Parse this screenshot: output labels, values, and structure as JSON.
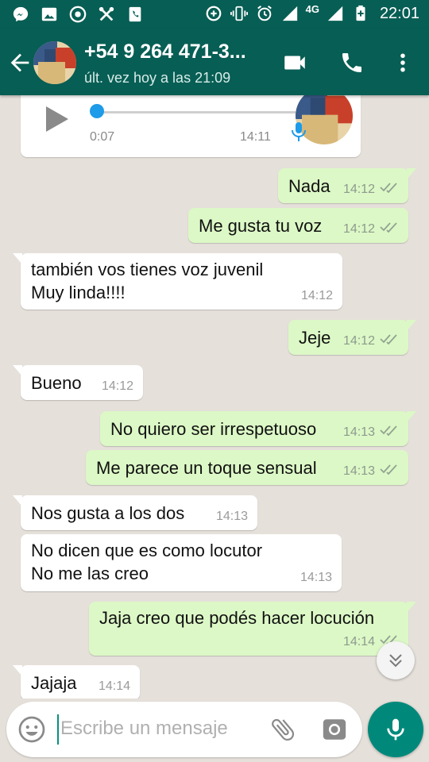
{
  "status_bar": {
    "time": "22:01",
    "network": "4G",
    "left_icons": [
      "messenger-icon",
      "gallery-icon",
      "chrome-icon",
      "tools-icon",
      "phone-app-icon"
    ],
    "right_icons": [
      "data-saver-icon",
      "vibrate-icon",
      "alarm-icon",
      "signal-icon",
      "signal-icon",
      "battery-charging-icon"
    ]
  },
  "header": {
    "contact_name": "+54 9 264 471-3...",
    "last_seen": "últ. vez hoy a las 21:09"
  },
  "voice_note": {
    "duration": "0:07",
    "time": "14:11",
    "progress": 0
  },
  "messages": [
    {
      "dir": "out",
      "lines": [
        "Nada"
      ],
      "time": "14:12"
    },
    {
      "dir": "out",
      "lines": [
        "Me gusta tu voz"
      ],
      "time": "14:12"
    },
    {
      "dir": "in",
      "lines": [
        "también vos tienes voz juvenil",
        "Muy linda!!!!"
      ],
      "time": "14:12"
    },
    {
      "dir": "out",
      "lines": [
        "Jeje"
      ],
      "time": "14:12"
    },
    {
      "dir": "in",
      "lines": [
        "Bueno"
      ],
      "time": "14:12"
    },
    {
      "dir": "out",
      "lines": [
        "No quiero ser irrespetuoso"
      ],
      "time": "14:13"
    },
    {
      "dir": "out",
      "lines": [
        "Me parece un toque sensual"
      ],
      "time": "14:13"
    },
    {
      "dir": "in",
      "lines": [
        "Nos gusta a los dos"
      ],
      "time": "14:13"
    },
    {
      "dir": "in",
      "lines": [
        "No dicen que es como locutor",
        "No me las creo"
      ],
      "time": "14:13"
    },
    {
      "dir": "out",
      "lines": [
        "Jaja creo que podés hacer locución"
      ],
      "time": "14:14"
    },
    {
      "dir": "in",
      "lines": [
        "Jajaja"
      ],
      "time": "14:14"
    }
  ],
  "composer": {
    "placeholder": "Escribe un mensaje"
  },
  "colors": {
    "header": "#075e54",
    "outgoing_bubble": "#dcf8c6",
    "incoming_bubble": "#ffffff",
    "chat_background": "#e5e0da",
    "mic_button": "#00897b",
    "voice_knob": "#1e9be9"
  }
}
